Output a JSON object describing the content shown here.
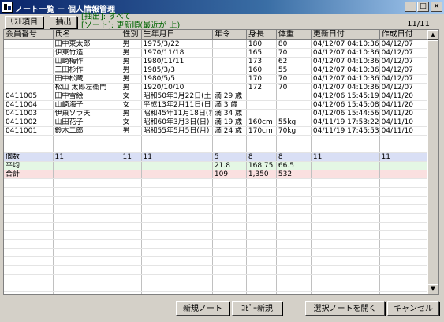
{
  "window": {
    "title": "ノート一覧 － 個人情報管理",
    "minimize": "_",
    "maximize": "□",
    "close": "×"
  },
  "toolbar": {
    "list_items_label": "ﾘｽﾄ項目",
    "extract_label": "抽出"
  },
  "filter": {
    "extract_info": "[抽出]: すべて",
    "sort_info": "[ソート]: 更新順(最近が 上)"
  },
  "page_info": "11/11",
  "columns": [
    "会員番号",
    "氏名",
    "性別",
    "生年月日",
    "年令",
    "身長",
    "体重",
    "更新日付",
    "作成日付"
  ],
  "rows": [
    [
      "",
      "田中東太郎",
      "男",
      "1975/3/22",
      "",
      "180",
      "80",
      "04/12/07 04:10:36",
      "04/12/07"
    ],
    [
      "",
      "伊東竹造",
      "男",
      "1970/11/18",
      "",
      "165",
      "70",
      "04/12/07 04:10:36",
      "04/12/07"
    ],
    [
      "",
      "山崎梅作",
      "男",
      "1980/11/11",
      "",
      "173",
      "62",
      "04/12/07 04:10:36",
      "04/12/07"
    ],
    [
      "",
      "三田杉作",
      "男",
      "1985/3/3",
      "",
      "160",
      "55",
      "04/12/07 04:10:36",
      "04/12/07"
    ],
    [
      "",
      "田中松蔵",
      "男",
      "1980/5/5",
      "",
      "170",
      "70",
      "04/12/07 04:10:36",
      "04/12/07"
    ],
    [
      "",
      "松山 太郎左衛門",
      "男",
      "1920/10/10",
      "",
      "172",
      "70",
      "04/12/07 04:10:36",
      "04/12/07"
    ],
    [
      "0411005",
      "田中雪絵",
      "女",
      "昭和50年3月22日(土",
      "満 29 歳",
      "",
      "",
      "04/12/06 15:45:19",
      "04/11/20"
    ],
    [
      "0411004",
      "山崎海子",
      "女",
      "平成13年2月11日(日",
      "満 3 歳",
      "",
      "",
      "04/12/06 15:45:08",
      "04/11/20"
    ],
    [
      "0411003",
      "伊東ソラ夫",
      "男",
      "昭和45年11月18日(ｵ",
      "満 34 歳",
      "",
      "",
      "04/12/06 15:44:56",
      "04/11/20"
    ],
    [
      "0411002",
      "山田花子",
      "女",
      "昭和60年3月3日(日)",
      "満 19 歳",
      "160cm",
      "55kg",
      "04/11/19 17:53:22",
      "04/11/10"
    ],
    [
      "0411001",
      "鈴木二郎",
      "男",
      "昭和55年5月5日(月)",
      "満 24 歳",
      "170cm",
      "70kg",
      "04/11/19 17:45:53",
      "04/11/10"
    ]
  ],
  "summary": {
    "count": [
      "個数",
      "11",
      "11",
      "11",
      "5",
      "8",
      "8",
      "11",
      "11"
    ],
    "average": [
      "平均",
      "",
      "",
      "",
      "21.8",
      "168.75",
      "66.5",
      "",
      ""
    ],
    "total": [
      "合計",
      "",
      "",
      "",
      "109",
      "1,350",
      "532",
      "",
      ""
    ]
  },
  "buttons": {
    "new_note": "新規ノート",
    "copy_new": "ｺﾋﾟｰ新規",
    "open_selected": "選択ノートを開く",
    "cancel": "キャンセル"
  }
}
